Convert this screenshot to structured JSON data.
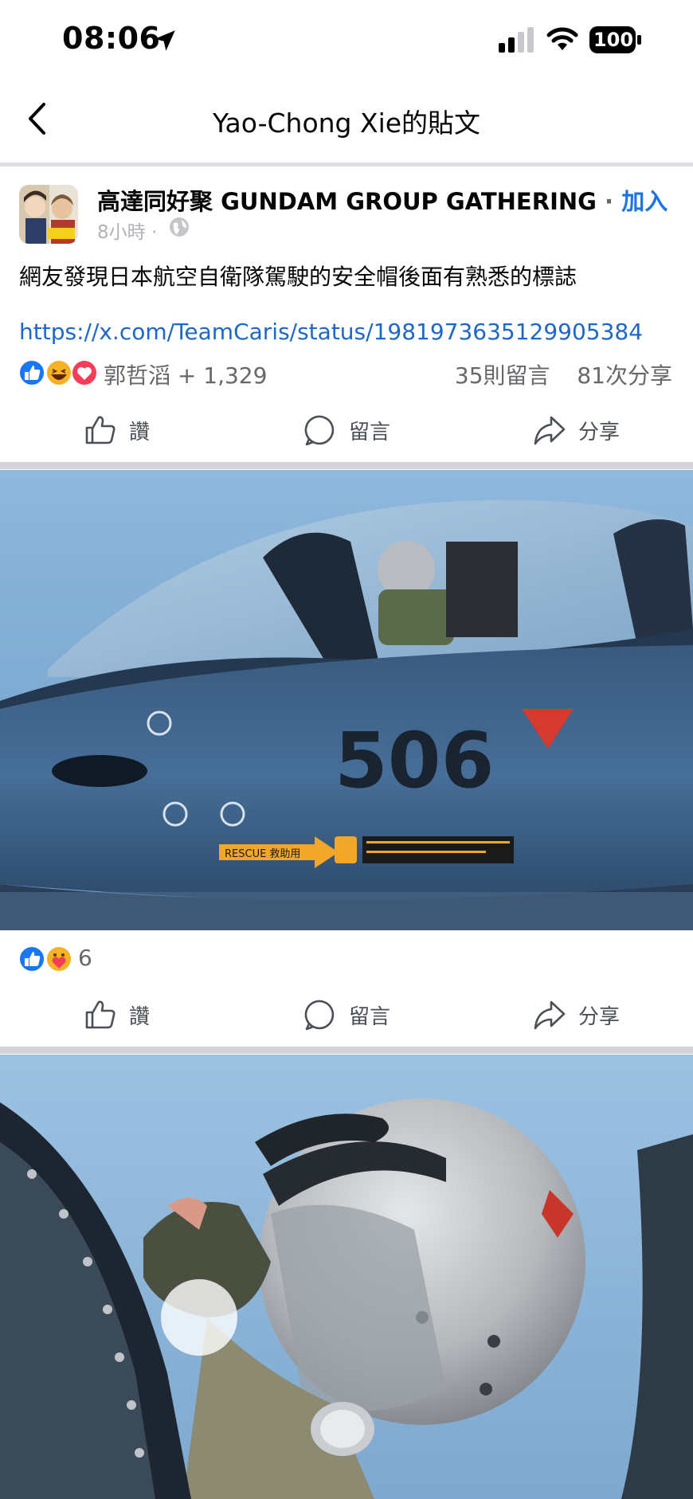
{
  "status_bar": {
    "time": "08:06",
    "battery": "100"
  },
  "header": {
    "title": "Yao-Chong Xie的貼文"
  },
  "post": {
    "group_name": "高達同好聚 GUNDAM GROUP GATHERING",
    "separator": "·",
    "join_label": "加入",
    "time": "8小時",
    "time_sep": "·",
    "text": "網友發現日本航空自衛隊駕駛的安全帽後面有熟悉的標誌",
    "link": "https://x.com/TeamCaris/status/1981973635129905384",
    "reactors": "郭哲滔 + 1,329",
    "comments": "35則留言",
    "shares": "81次分享",
    "reactions": [
      "like-icon",
      "haha-icon",
      "love-icon"
    ]
  },
  "actions": {
    "like": "讚",
    "comment": "留言",
    "share": "分享"
  },
  "photo1": {
    "aircraft_number": "506",
    "rescue_label": "RESCUE 救助用",
    "reactions": [
      "like-icon",
      "care-icon"
    ],
    "reaction_count": "6"
  },
  "colors": {
    "link_blue": "#1b74e4",
    "text_secondary": "#65676b",
    "like_blue": "#1877f2",
    "love_red": "#f33e58"
  }
}
